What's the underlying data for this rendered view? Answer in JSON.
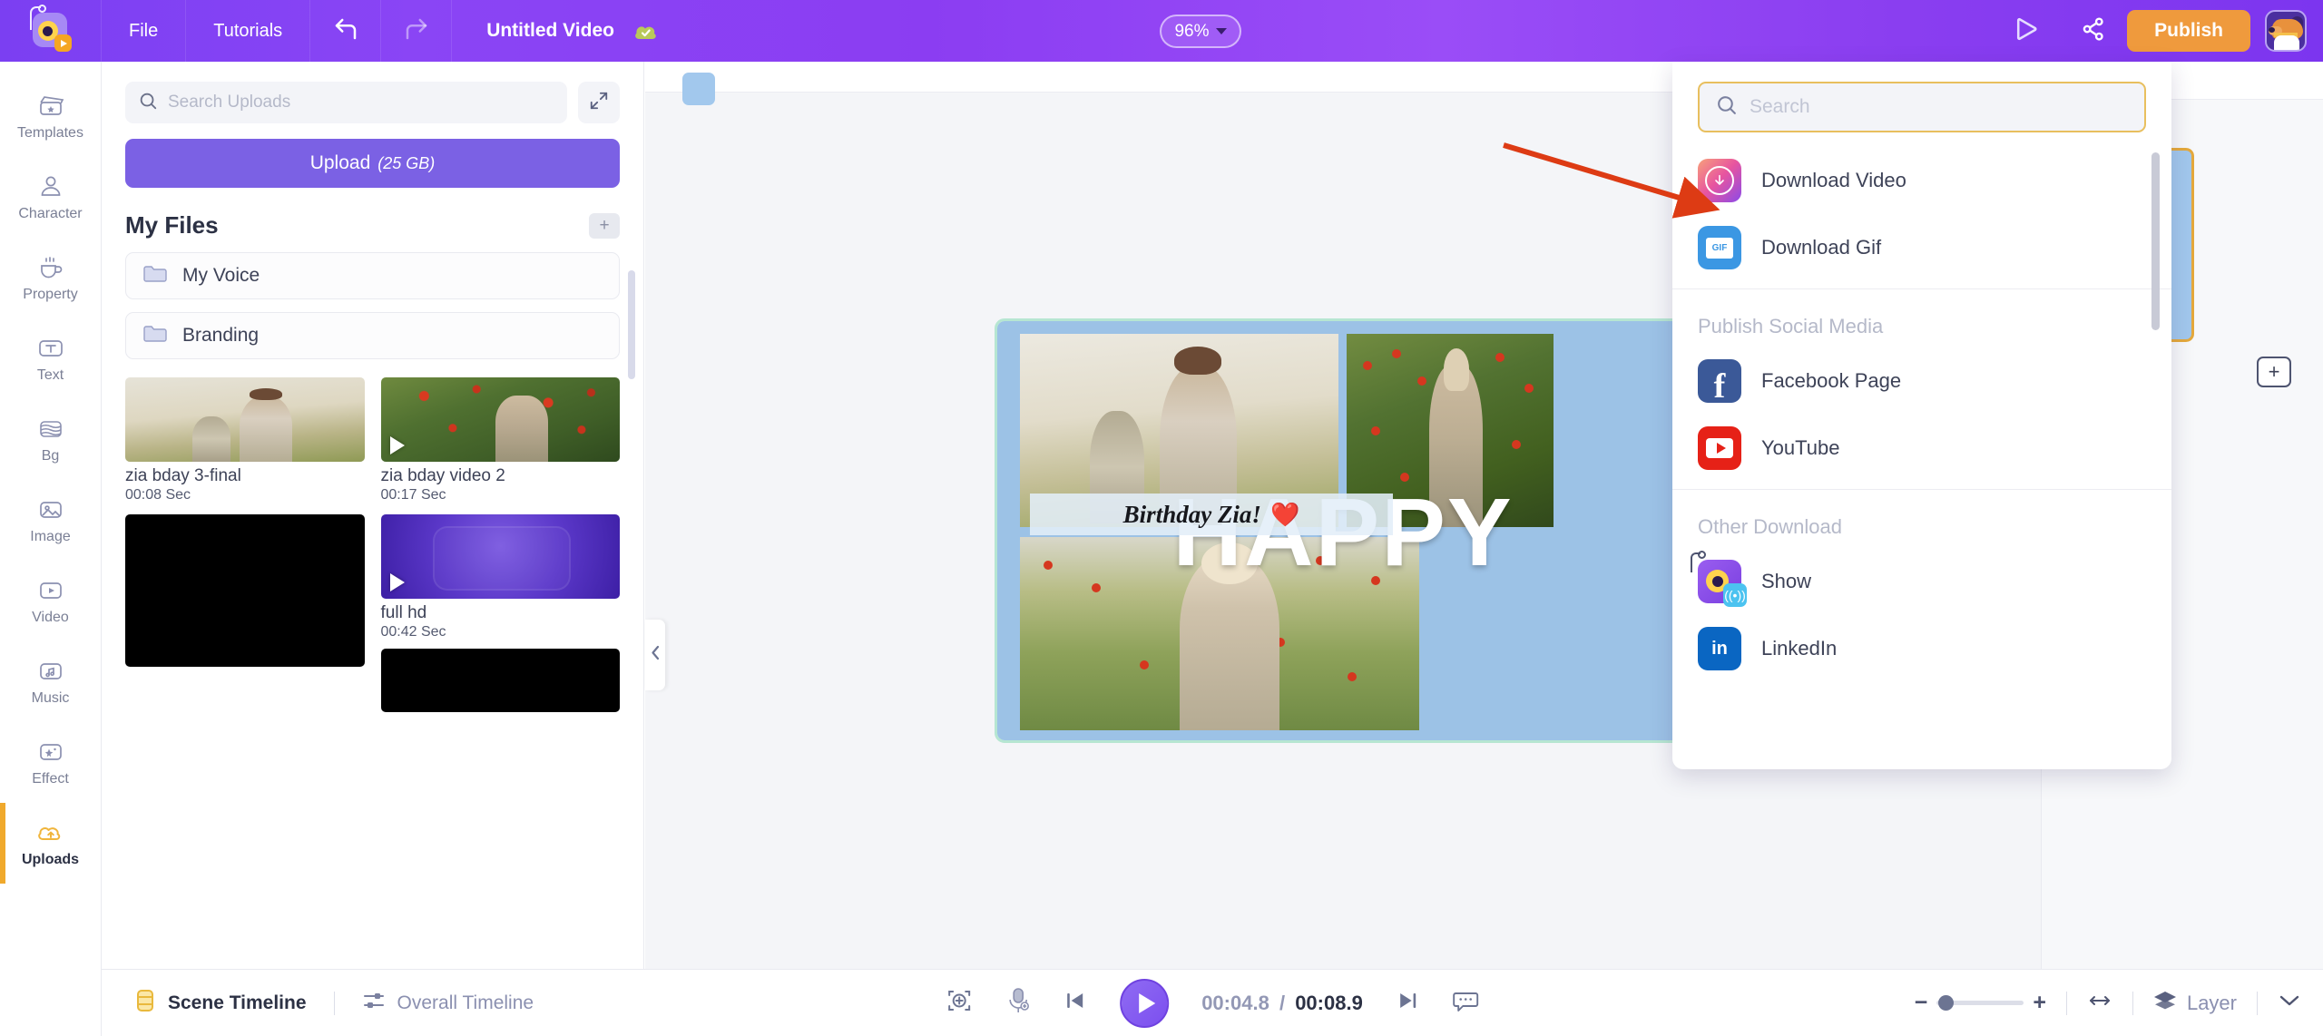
{
  "topbar": {
    "logo_name": "app-logo",
    "menu": [
      {
        "label": "File",
        "name": "file-menu"
      },
      {
        "label": "Tutorials",
        "name": "tutorials-menu"
      }
    ],
    "undo_icon": "undo-icon",
    "redo_icon": "redo-icon",
    "project_title": "Untitled Video",
    "saved_icon": "cloud-saved-icon",
    "zoom_level": "96%",
    "preview_icon": "preview-play-icon",
    "share_icon": "share-icon",
    "publish_label": "Publish",
    "avatar_name": "user-avatar"
  },
  "rail": {
    "items": [
      {
        "label": "Templates",
        "icon": "templates-icon"
      },
      {
        "label": "Character",
        "icon": "character-icon"
      },
      {
        "label": "Property",
        "icon": "property-icon"
      },
      {
        "label": "Text",
        "icon": "text-icon"
      },
      {
        "label": "Bg",
        "icon": "background-icon"
      },
      {
        "label": "Image",
        "icon": "image-icon"
      },
      {
        "label": "Video",
        "icon": "video-icon"
      },
      {
        "label": "Music",
        "icon": "music-icon"
      },
      {
        "label": "Effect",
        "icon": "effect-icon"
      },
      {
        "label": "Uploads",
        "icon": "uploads-cloud-icon"
      }
    ]
  },
  "uploads_panel": {
    "search_placeholder": "Search Uploads",
    "search_value": "",
    "expand_icon": "expand-icon",
    "upload_label": "Upload",
    "upload_quota": "(25 GB)",
    "section_title": "My Files",
    "add_folder_icon": "add-folder-icon",
    "folders": [
      {
        "name": "My Voice"
      },
      {
        "name": "Branding"
      }
    ],
    "assets": [
      {
        "name": "zia bday 3-final",
        "duration": "00:08 Sec",
        "thumb": "photo-mother-child",
        "has_play": false
      },
      {
        "name": "zia bday video 2",
        "duration": "00:17 Sec",
        "thumb": "photo-girl-poppies",
        "has_play": true
      },
      {
        "name": "",
        "duration": "",
        "thumb": "black",
        "has_play": false
      },
      {
        "name": "full hd",
        "duration": "00:42 Sec",
        "thumb": "purple-hex",
        "has_play": true
      },
      {
        "name": "",
        "duration": "",
        "thumb": "black2",
        "has_play": false
      }
    ]
  },
  "canvas": {
    "collapse_icon": "collapse-left-chevron-icon",
    "headline": "HAPPY",
    "caption": "Birthday Zia!",
    "heart": "❤️"
  },
  "scenes_panel": {
    "add_scene_label": "+",
    "selected_scene_border": "#e5a93c"
  },
  "publish_menu": {
    "search_placeholder": "Search",
    "search_value": "",
    "search_icon": "search-icon",
    "items_top": [
      {
        "label": "Download Video",
        "icon": "download-video-icon"
      },
      {
        "label": "Download Gif",
        "icon": "download-gif-icon"
      }
    ],
    "section_social": "Publish Social Media",
    "items_social": [
      {
        "label": "Facebook Page",
        "icon": "facebook-icon"
      },
      {
        "label": "YouTube",
        "icon": "youtube-icon"
      }
    ],
    "section_other": "Other Download",
    "items_other": [
      {
        "label": "Show",
        "icon": "show-app-icon"
      },
      {
        "label": "LinkedIn",
        "icon": "linkedin-icon"
      }
    ]
  },
  "bottombar": {
    "scene_timeline_label": "Scene Timeline",
    "overall_timeline_label": "Overall Timeline",
    "scene_timeline_icon": "scene-timeline-icon",
    "overall_timeline_icon": "overall-timeline-icon",
    "add_scene_icon": "add-scene-icon",
    "mic_icon": "record-voice-icon",
    "prev_icon": "previous-frame-icon",
    "play_icon": "play-icon",
    "next_icon": "next-frame-icon",
    "subtitle_icon": "subtitle-icon",
    "current_time": "00:04.8",
    "separator": "/",
    "total_time": "00:08.9",
    "zoom_minus": "−",
    "zoom_plus": "+",
    "fit_icon": "fit-width-icon",
    "layer_icon": "layers-icon",
    "layer_label": "Layer",
    "chevron_icon": "chevron-down-icon"
  },
  "annotation": {
    "arrow_name": "red-pointer-arrow",
    "arrow_color": "#dd3b14"
  },
  "colors": {
    "brand_purple": "#7b3ff2",
    "accent_orange": "#ef9a3d",
    "panel_bg": "#f4f5f8",
    "selected_yellow": "#e5a93c"
  }
}
